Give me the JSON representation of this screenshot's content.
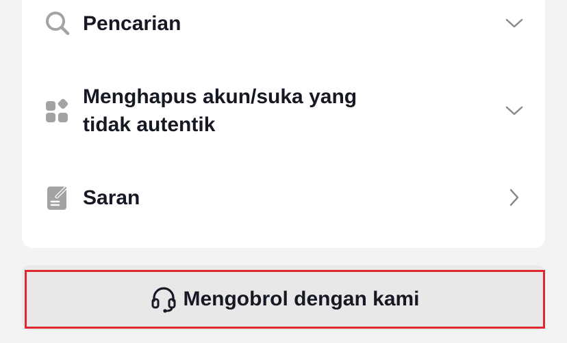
{
  "menu": {
    "items": [
      {
        "label": "Pencarian",
        "icon": "search-icon",
        "indicator": "chevron-down-icon"
      },
      {
        "label_line1": "Menghapus akun/suka yang",
        "label_line2": "tidak autentik",
        "icon": "apps-icon",
        "indicator": "chevron-down-icon"
      },
      {
        "label": "Saran",
        "icon": "edit-note-icon",
        "indicator": "chevron-right-icon"
      }
    ]
  },
  "chat": {
    "label": "Mengobrol dengan kami",
    "icon": "headset-icon"
  },
  "colors": {
    "background": "#f3f3f3",
    "card": "#ffffff",
    "text": "#161823",
    "icon_gray": "#a3a3a3",
    "highlight_border": "#e0262f"
  }
}
